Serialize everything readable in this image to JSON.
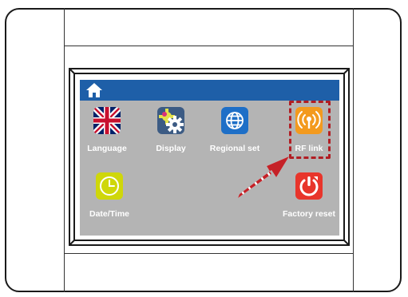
{
  "screen": {
    "home_icon": "home-icon",
    "tiles": [
      {
        "label": "Language",
        "icon": "uk-flag-icon"
      },
      {
        "label": "Display",
        "icon": "gears-icon"
      },
      {
        "label": "Regional set",
        "icon": "globe-icon"
      },
      {
        "label": "RF link",
        "icon": "wireless-signal-icon"
      },
      {
        "label": "Date/Time",
        "icon": "clock-icon"
      },
      {
        "label": "Factory reset",
        "icon": "power-reset-icon"
      }
    ]
  },
  "colors": {
    "topbar": "#1e5fa8",
    "screen_bg": "#b4b4b4",
    "rf_link": "#f39a1e",
    "date_time": "#cfd70a",
    "factory_reset": "#e8352b",
    "regional": "#1e6fc7",
    "display": "#3c5b84",
    "highlight": "#b11d23"
  }
}
